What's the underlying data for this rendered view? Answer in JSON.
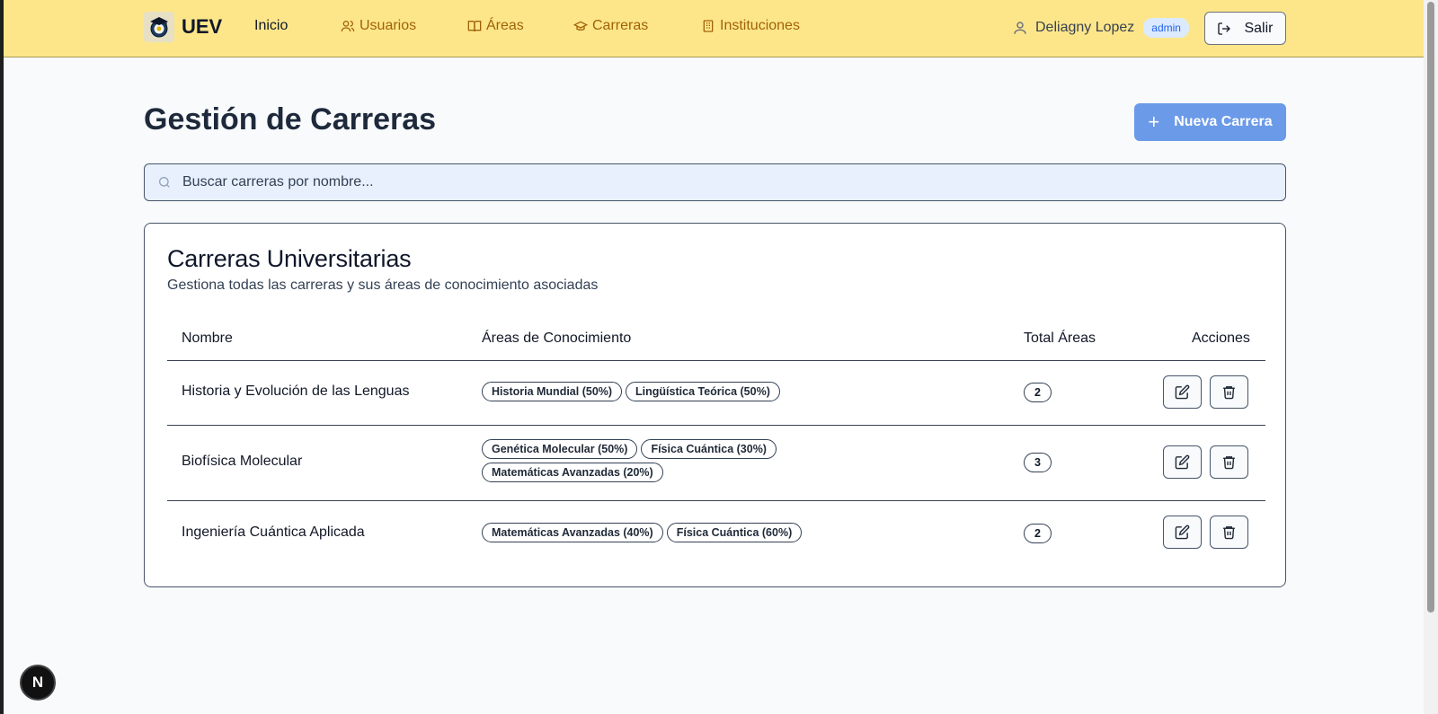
{
  "navbar": {
    "brand": "UEV",
    "items": [
      {
        "label": "Inicio"
      },
      {
        "label": "Usuarios"
      },
      {
        "label": "Áreas"
      },
      {
        "label": "Carreras"
      },
      {
        "label": "Instituciones"
      }
    ],
    "user_name": "Deliagny Lopez",
    "role_badge": "admin",
    "logout_label": "Salir"
  },
  "page": {
    "title": "Gestión de Carreras",
    "new_button_label": "Nueva Carrera"
  },
  "search": {
    "placeholder": "Buscar carreras por nombre..."
  },
  "card": {
    "title": "Carreras Universitarias",
    "subtitle": "Gestiona todas las carreras y sus áreas de conocimiento asociadas",
    "columns": [
      "Nombre",
      "Áreas de Conocimiento",
      "Total Áreas",
      "Acciones"
    ],
    "rows": [
      {
        "name": "Historia y Evolución de las Lenguas",
        "areas": [
          "Historia Mundial (50%)",
          "Lingüística Teórica (50%)"
        ],
        "total": "2"
      },
      {
        "name": "Biofísica Molecular",
        "areas": [
          "Genética Molecular (50%)",
          "Física Cuántica (30%)",
          "Matemáticas Avanzadas (20%)"
        ],
        "total": "3"
      },
      {
        "name": "Ingeniería Cuántica Aplicada",
        "areas": [
          "Matemáticas Avanzadas (40%)",
          "Física Cuántica (60%)"
        ],
        "total": "2"
      }
    ]
  },
  "dev_badge": "N",
  "colors": {
    "navbar_bg": "#fde68a",
    "nav_link": "#a16207",
    "primary_button": "#6b9ae8",
    "admin_badge_bg": "#dbeafe"
  }
}
